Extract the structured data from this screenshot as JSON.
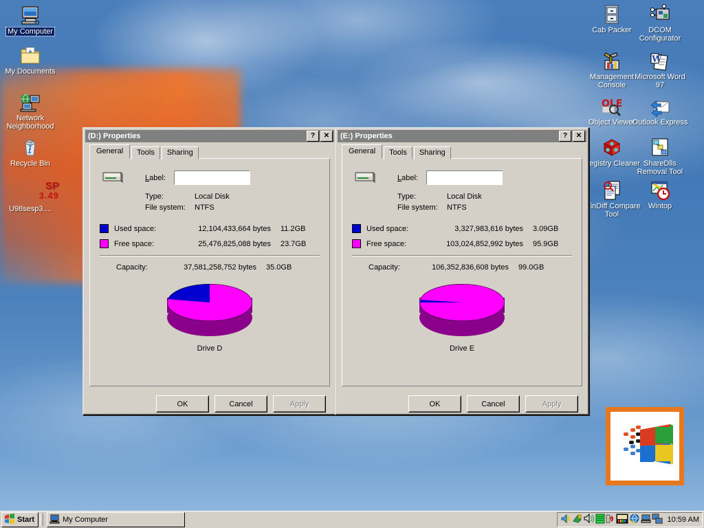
{
  "desktop": {
    "icons_left": [
      {
        "label": "My Computer",
        "icon": "my-computer-icon",
        "selected": true
      },
      {
        "label": "My Documents",
        "icon": "my-documents-folder-icon",
        "selected": false
      },
      {
        "label": "Network Neighborhood",
        "icon": "network-neighborhood-icon",
        "selected": false
      },
      {
        "label": "Recycle Bin",
        "icon": "recycle-bin-icon",
        "selected": false
      },
      {
        "label": "U98sesp3....",
        "icon": "service-pack-icon",
        "badge_top": "SP",
        "badge_bottom": "3.49",
        "selected": false
      }
    ],
    "icons_right": [
      {
        "label": "Cab Packer",
        "icon": "cab-packer-icon"
      },
      {
        "label": "DCOM Configurator",
        "icon": "dcom-configurator-icon"
      },
      {
        "label": "Management Console",
        "icon": "management-console-icon"
      },
      {
        "label": "Microsoft Word 97",
        "icon": "microsoft-word-icon"
      },
      {
        "label": "Object Viewer",
        "icon": "ole-object-viewer-icon"
      },
      {
        "label": "Outlook Express",
        "icon": "outlook-express-icon"
      },
      {
        "label": "Registry Cleaner",
        "icon": "registry-cleaner-icon"
      },
      {
        "label": "ShareDlls Removal Tool",
        "icon": "sharedlls-removal-icon"
      },
      {
        "label": "WinDiff Compare Tool",
        "icon": "windiff-icon"
      },
      {
        "label": "Wintop",
        "icon": "wintop-icon"
      }
    ],
    "logo_tile": {
      "name": "windows-logo-tile",
      "border_color": "#e8781e"
    }
  },
  "colors": {
    "used_space": "#0000d0",
    "free_space": "#ff00ff",
    "pie_side": "#8b008b",
    "dialog_face": "#d4d0c8",
    "titlebar": "#808080"
  },
  "dialogs": [
    {
      "title": "(D:) Properties",
      "help_button": "?",
      "close_button": "✕",
      "tabs": [
        {
          "label": "General",
          "active": true
        },
        {
          "label": "Tools",
          "active": false
        },
        {
          "label": "Sharing",
          "active": false
        }
      ],
      "label_field": {
        "caption": "Label:",
        "value": "",
        "placeholder": ""
      },
      "type_caption": "Type:",
      "type_value": "Local Disk",
      "filesystem_caption": "File system:",
      "filesystem_value": "NTFS",
      "used_caption": "Used space:",
      "used_bytes": "12,104,433,664 bytes",
      "used_gb": "11.2GB",
      "free_caption": "Free space:",
      "free_bytes": "25,476,825,088 bytes",
      "free_gb": "23.7GB",
      "capacity_caption": "Capacity:",
      "capacity_bytes": "37,581,258,752 bytes",
      "capacity_gb": "35.0GB",
      "pie_caption": "Drive D",
      "buttons": [
        {
          "label": "OK",
          "disabled": false
        },
        {
          "label": "Cancel",
          "disabled": false
        },
        {
          "label": "Apply",
          "disabled": true
        }
      ]
    },
    {
      "title": "(E:) Properties",
      "help_button": "?",
      "close_button": "✕",
      "tabs": [
        {
          "label": "General",
          "active": true
        },
        {
          "label": "Tools",
          "active": false
        },
        {
          "label": "Sharing",
          "active": false
        }
      ],
      "label_field": {
        "caption": "Label:",
        "value": "",
        "placeholder": ""
      },
      "type_caption": "Type:",
      "type_value": "Local Disk",
      "filesystem_caption": "File system:",
      "filesystem_value": "NTFS",
      "used_caption": "Used space:",
      "used_bytes": "3,327,983,616 bytes",
      "used_gb": "3.09GB",
      "free_caption": "Free space:",
      "free_bytes": "103,024,852,992 bytes",
      "free_gb": "95.9GB",
      "capacity_caption": "Capacity:",
      "capacity_bytes": "106,352,836,608 bytes",
      "capacity_gb": "99.0GB",
      "pie_caption": "Drive E",
      "buttons": [
        {
          "label": "OK",
          "disabled": false
        },
        {
          "label": "Cancel",
          "disabled": false
        },
        {
          "label": "Apply",
          "disabled": true
        }
      ]
    }
  ],
  "chart_data": [
    {
      "type": "pie",
      "title": "Drive D",
      "categories": [
        "Used space",
        "Free space"
      ],
      "values": [
        12104433664,
        25476825088
      ],
      "percents": [
        32.2,
        67.8
      ],
      "colors": [
        "#0000d0",
        "#ff00ff"
      ],
      "legend": "left-panel",
      "labels": [
        "11.2GB",
        "23.7GB"
      ]
    },
    {
      "type": "pie",
      "title": "Drive E",
      "categories": [
        "Used space",
        "Free space"
      ],
      "values": [
        3327983616,
        103024852992
      ],
      "percents": [
        3.1,
        96.9
      ],
      "colors": [
        "#0000d0",
        "#ff00ff"
      ],
      "legend": "left-panel",
      "labels": [
        "3.09GB",
        "95.9GB"
      ]
    }
  ],
  "taskbar": {
    "start_label": "Start",
    "tasks": [
      {
        "label": "My Computer",
        "icon": "my-computer-icon",
        "active": true
      }
    ],
    "tray_icons": [
      "volume-icon",
      "display-icon",
      "speaker-icon",
      "battery-icon",
      "modem-icon",
      "sound-mixer-icon",
      "internet-icon",
      "scanner-icon",
      "network-icon"
    ],
    "clock": "10:59 AM"
  }
}
